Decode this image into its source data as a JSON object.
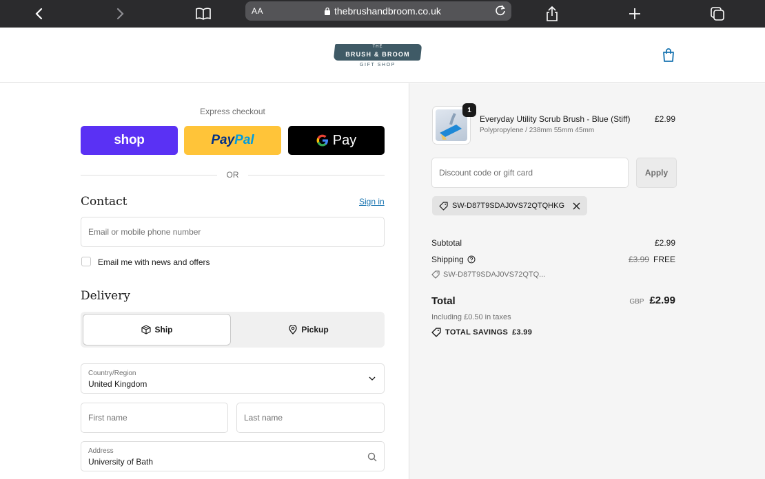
{
  "browser": {
    "font_size_label": "AA",
    "url": "thebrushandbroom.co.uk"
  },
  "header": {
    "logo_top": "THE",
    "logo_main": "BRUSH & BROOM",
    "logo_sub": "GIFT SHOP"
  },
  "express": {
    "label": "Express checkout",
    "shop_label": "shop",
    "paypal_part1": "Pay",
    "paypal_part2": "Pal",
    "gpay_label": "Pay",
    "or_label": "OR"
  },
  "contact": {
    "title": "Contact",
    "signin_label": "Sign in",
    "email_placeholder": "Email or mobile phone number",
    "newsletter_label": "Email me with news and offers"
  },
  "delivery": {
    "title": "Delivery",
    "tab_ship": "Ship",
    "tab_pickup": "Pickup",
    "country_label": "Country/Region",
    "country_value": "United Kingdom",
    "first_name_placeholder": "First name",
    "last_name_placeholder": "Last name",
    "address_label": "Address",
    "address_value": "University of Bath"
  },
  "summary": {
    "product_name": "Everyday Utility Scrub Brush - Blue (Stiff)",
    "product_variant": "Polypropylene / 238mm 55mm 45mm",
    "product_price": "£2.99",
    "quantity": "1",
    "discount_placeholder": "Discount code or gift card",
    "apply_label": "Apply",
    "applied_code": "SW-D87T9SDAJ0VS72QTQHKG",
    "subtotal_label": "Subtotal",
    "subtotal_value": "£2.99",
    "shipping_label": "Shipping",
    "shipping_original": "£3.99",
    "shipping_value": "FREE",
    "code_line": "SW-D87T9SDAJ0VS72QTQ...",
    "total_label": "Total",
    "total_currency": "GBP",
    "total_value": "£2.99",
    "taxes_line": "Including £0.50 in taxes",
    "savings_label": "TOTAL SAVINGS",
    "savings_value": "£3.99"
  },
  "colors": {
    "shop_purple": "#5a31f4",
    "paypal_yellow": "#ffc439",
    "link_blue": "#1773b0",
    "brand_slate": "#3f5a66"
  }
}
